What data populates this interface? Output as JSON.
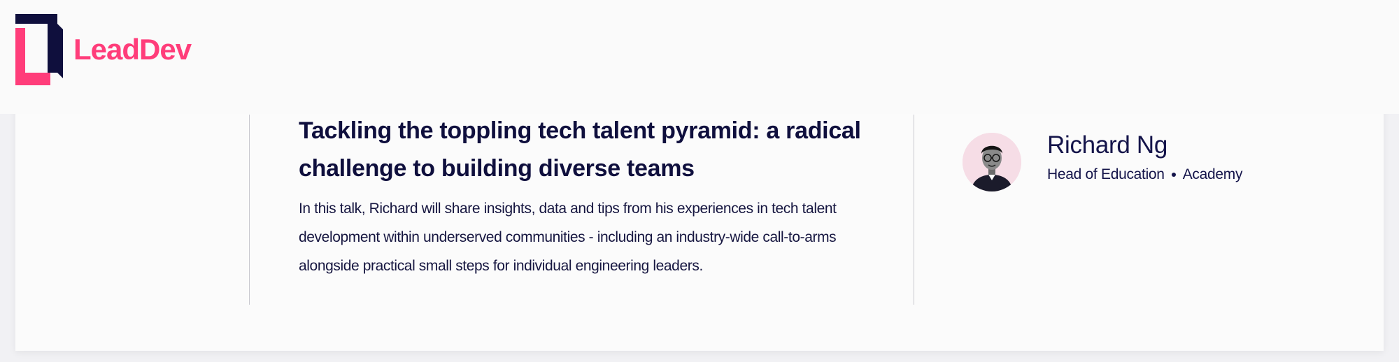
{
  "brand": {
    "name": "LeadDev",
    "primary_color": "#ff3d7a",
    "dark_color": "#0f0f3d"
  },
  "talk": {
    "title": "Tackling the toppling tech talent pyramid: a radical challenge to building diverse teams",
    "description": "In this talk, Richard will share insights, data and tips from his experiences in tech talent development within underserved communities - including an industry-wide call-to-arms alongside practical small steps for individual engineering leaders."
  },
  "speaker": {
    "name": "Richard Ng",
    "role": "Head of Education",
    "organization": "Academy",
    "avatar_icon": "speaker-avatar"
  }
}
